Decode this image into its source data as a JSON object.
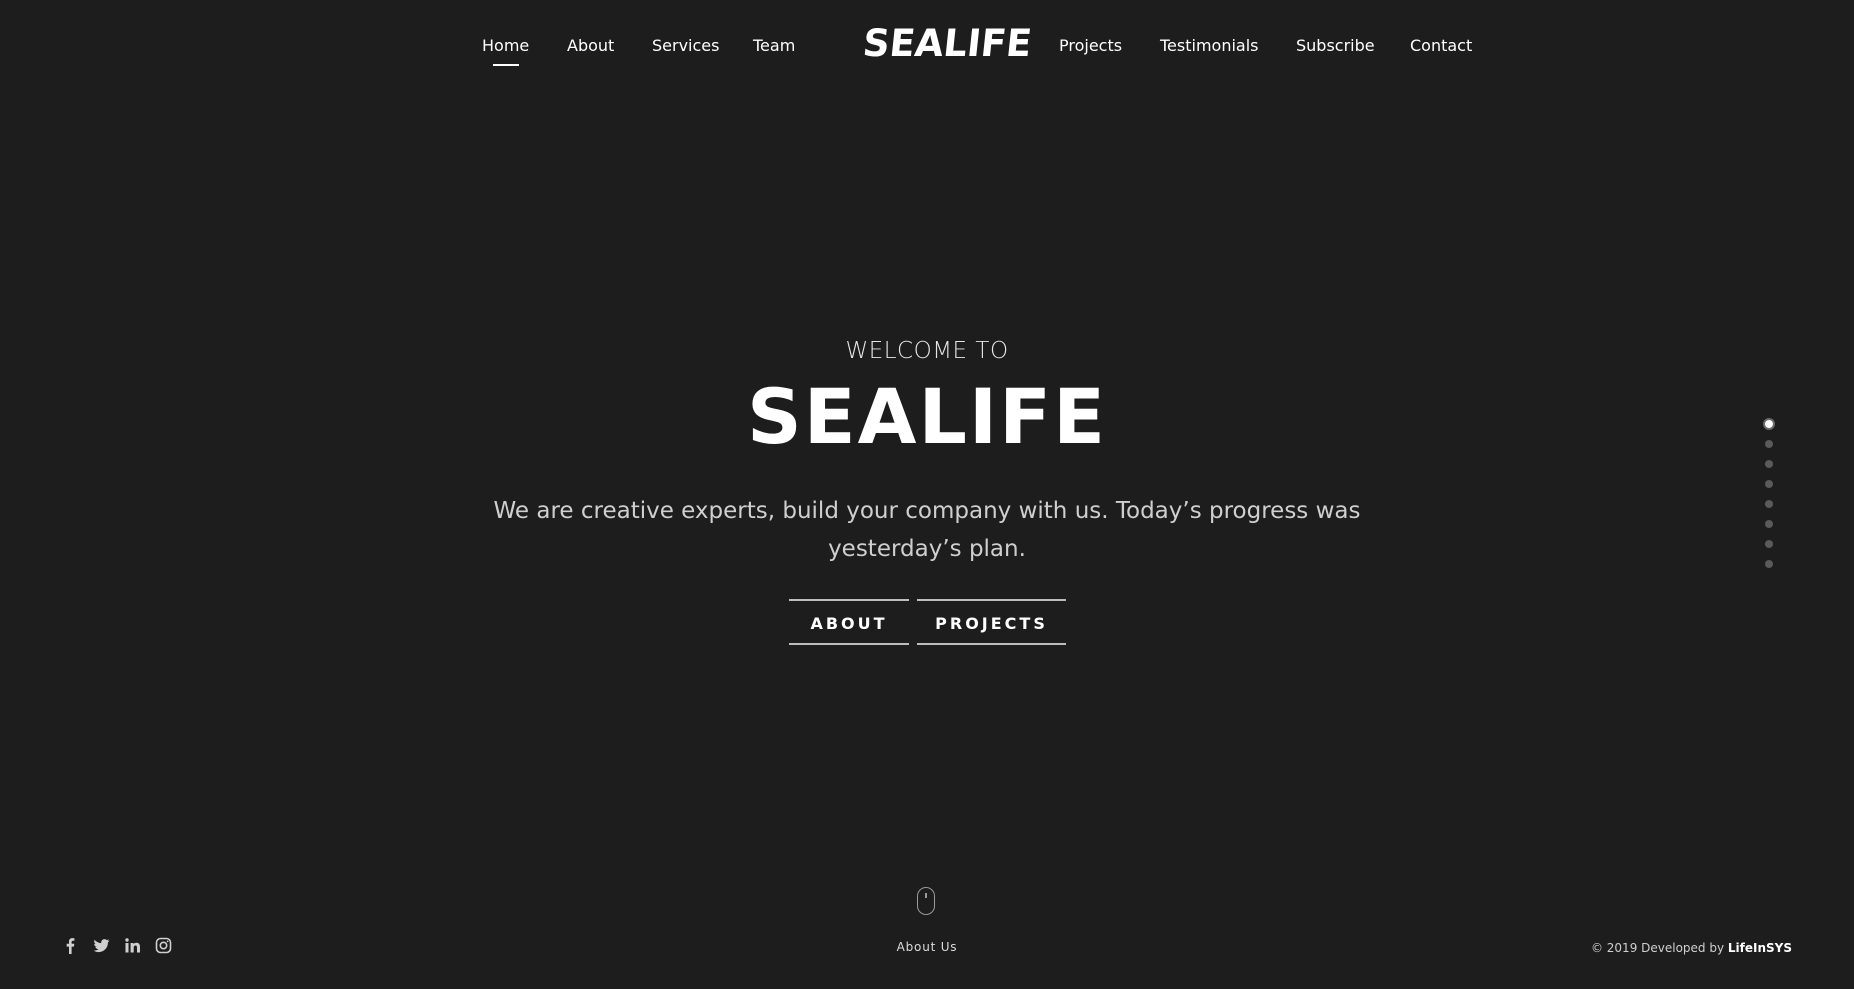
{
  "nav": {
    "left_items": [
      "Home",
      "About",
      "Services",
      "Team"
    ],
    "right_items": [
      "Projects",
      "Testimonials",
      "Subscribe",
      "Contact"
    ],
    "active": "Home",
    "logo": "SEALIFE"
  },
  "hero": {
    "welcome": "WELCOME TO",
    "title": "SEALIFE",
    "subtitle_line1": "We are creative experts, build your company with us. Today’s progress was",
    "subtitle_line2": "yesterday’s plan.",
    "buttons": {
      "about": "ABOUT",
      "projects": "PROJECTS"
    }
  },
  "pagination": {
    "total": 8,
    "active_index": 0
  },
  "footer": {
    "social_icons": [
      "facebook-icon",
      "twitter-icon",
      "linkedin-icon",
      "instagram-icon"
    ],
    "scroll_label": "About Us",
    "copyright_prefix": "© 2019 Developed by ",
    "copyright_brand": "LifeInSYS"
  },
  "colors": {
    "background": "#1d1d1d",
    "text": "#ffffff",
    "muted": "#cfcfcf",
    "dot_inactive": "#5a5a5a"
  }
}
